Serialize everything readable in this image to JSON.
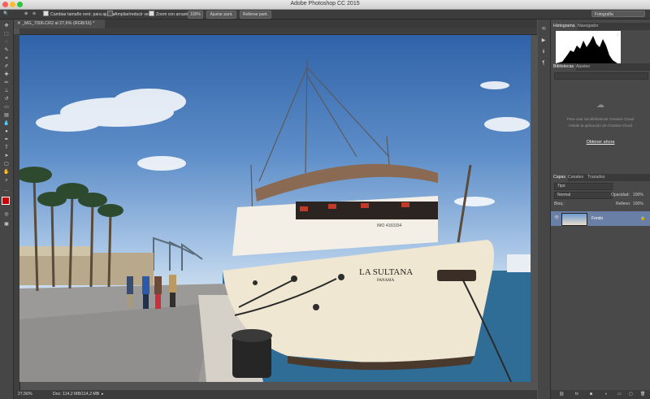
{
  "window": {
    "title": "Adobe Photoshop CC 2015",
    "traffic_colors": [
      "#ff5f57",
      "#febc2e",
      "#28c840"
    ]
  },
  "options_bar": {
    "resize_label": "Cambiar tamaño vent. para ajustar",
    "zoom_all_label": "Ampliar/reducir vent.",
    "scrubby_label": "Zoom con arrastre",
    "zoom_value": "100%",
    "fit_label": "Ajustar pant.",
    "fill_label": "Rellenar pant.",
    "workspace": "Fotografía"
  },
  "document": {
    "tab_label": "_MG_7006.CR2 al 27,6% (RGB/16) *"
  },
  "image": {
    "hull_name": "LA SULTANA",
    "hull_port": "PANAMA",
    "stern_plate": "IMO 4163334"
  },
  "status": {
    "zoom": "27,56%",
    "doc_info": "Doc: 114,2 MB/114,2 MB"
  },
  "histogram": {
    "tab": "Histograma",
    "nav_tab": "Navegador"
  },
  "libraries": {
    "tab": "Bibliotecas",
    "adjust_tab": "Ajustes",
    "message_line1": "Para usar las Bibliotecas Creative Cloud",
    "message_line2": "instale la aplicación de Creative Cloud",
    "link": "Obtener ahora"
  },
  "layers": {
    "tabs": [
      "Capas",
      "Canales",
      "Trazados"
    ],
    "kind_filter": "Tipo",
    "blend_mode": "Normal",
    "opacity_label": "Opacidad:",
    "opacity_value": "100%",
    "lock_label": "Bloq.:",
    "fill_label": "Relleno:",
    "fill_value": "100%",
    "layer_name": "Fondo"
  }
}
